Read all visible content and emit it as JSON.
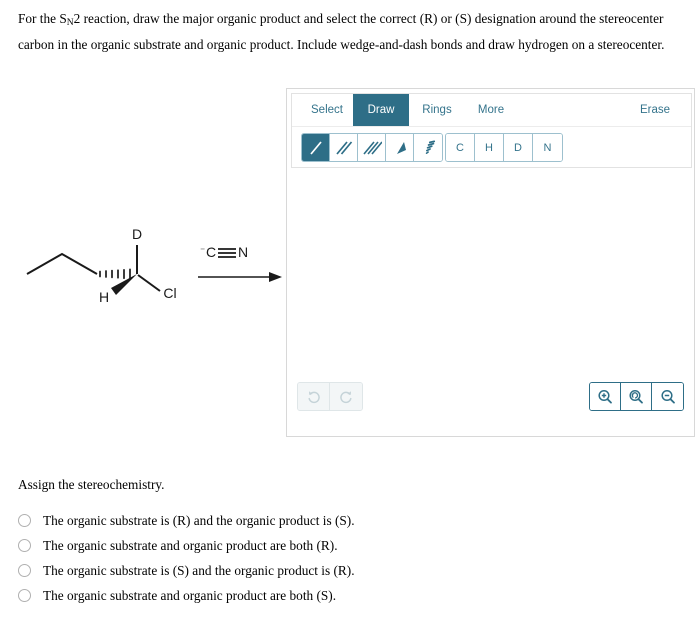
{
  "question": {
    "line1_pre": "For the S",
    "line1_sub": "N",
    "line1_post": "2 reaction, draw the major organic product and select the correct (R) or (S) designation around the stereocenter",
    "line2": "carbon in the organic substrate and organic product. Include wedge-and-dash bonds and draw hydrogen on a stereocenter.",
    "full_text": "For the SN2 reaction, draw the major organic product and select the correct (R) or (S) designation around the stereocenter carbon in the organic substrate and organic product. Include wedge-and-dash bonds and draw hydrogen on a stereocenter."
  },
  "editor": {
    "tabs": [
      {
        "label": "Select",
        "active": false
      },
      {
        "label": "Draw",
        "active": true
      },
      {
        "label": "Rings",
        "active": false
      },
      {
        "label": "More",
        "active": false
      }
    ],
    "erase_label": "Erase",
    "bond_tools": [
      {
        "name": "single-bond-tool",
        "active": true
      },
      {
        "name": "double-bond-tool",
        "active": false
      },
      {
        "name": "triple-bond-tool",
        "active": false
      },
      {
        "name": "wedge-bond-tool",
        "active": false
      },
      {
        "name": "hash-bond-tool",
        "active": false
      }
    ],
    "element_tools": [
      {
        "label": "C"
      },
      {
        "label": "H"
      },
      {
        "label": "D"
      },
      {
        "label": "N"
      }
    ],
    "history": [
      {
        "name": "undo-button",
        "glyph": "↺",
        "enabled": false
      },
      {
        "name": "redo-button",
        "glyph": "↻",
        "enabled": false
      }
    ],
    "zoom_controls": [
      {
        "name": "zoom-in-button",
        "symbol": "+"
      },
      {
        "name": "zoom-reset-button",
        "symbol": "reset"
      },
      {
        "name": "zoom-out-button",
        "symbol": "−"
      }
    ],
    "accent_color": "#2e6e87",
    "border_color": "#9dc0ce"
  },
  "reaction": {
    "substrate_labels": {
      "deuterium": "D",
      "hydrogen": "H",
      "chlorine": "Cl"
    },
    "reagent": {
      "charge": "⁻",
      "atom1": "C",
      "atom2": "N",
      "text": "⁻C≡N"
    }
  },
  "answer_section": {
    "instruction": "Assign the stereochemistry.",
    "options": [
      {
        "text": "The organic substrate is (R) and the organic product is (S).",
        "selected": false
      },
      {
        "text": "The organic substrate and organic product are both (R).",
        "selected": false
      },
      {
        "text": "The organic substrate is (S) and the organic product is (R).",
        "selected": false
      },
      {
        "text": "The organic substrate and organic product are both (S).",
        "selected": false
      }
    ]
  }
}
